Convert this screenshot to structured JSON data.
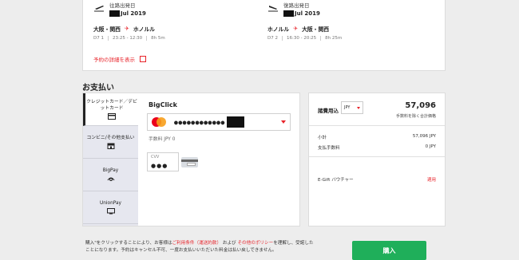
{
  "flight": {
    "outbound": {
      "label": "往路出発日",
      "date": "Jul 2019",
      "from": "大阪・関西",
      "to": "ホノルル",
      "flight_no": "D7 1",
      "time": "23:25 - 12:30",
      "duration": "8h 5m"
    },
    "inbound": {
      "label": "復路出発日",
      "date": "Jul 2019",
      "from": "ホノルル",
      "to": "大阪・関西",
      "flight_no": "D7 2",
      "time": "16:30 - 20:25",
      "duration": "8h 25m"
    },
    "detail_link": "予約の詳細を表示"
  },
  "payment": {
    "section_title": "お支払い",
    "methods": [
      {
        "label": "クレジットカード／デビットカード",
        "icon": "credit-card-icon"
      },
      {
        "label": "コンビニ/その他支払い",
        "icon": "store-icon"
      },
      {
        "label": "BigPay",
        "icon": "bigpay-icon"
      },
      {
        "label": "UnionPay",
        "icon": "monitor-icon"
      }
    ],
    "bigclick_title": "BigClick",
    "card_masked": "●●●●●●●●●●●●",
    "fee_label": "手数料 JPY 0",
    "cvv_label": "CVV",
    "cvv_value": "●●●"
  },
  "summary": {
    "label": "諸費用込",
    "currency": "JPY",
    "total": "57,096",
    "total_note": "手数料を除く合計価格",
    "subtotal_label": "小計",
    "subtotal_value": "57,096 JPY",
    "fee_label": "支払手数料",
    "fee_value": "0 JPY",
    "egift_label": "E-Gift バウチャー",
    "egift_action": "適用"
  },
  "terms": {
    "text1": "購入\"をクリックすることにより、お客様は",
    "link1": "ご利用条件（運送約款）",
    "text2": "および",
    "link2": "その他のポリシー",
    "text3": "を理解し、受諾したことになります。予約はキャンセル不可、一度お支払いいただいた料金は払い戻しできま",
    "text4": "せん。"
  },
  "buy_button": "購入",
  "colors": {
    "accent": "#e8232a",
    "buy": "#1faf5a"
  }
}
